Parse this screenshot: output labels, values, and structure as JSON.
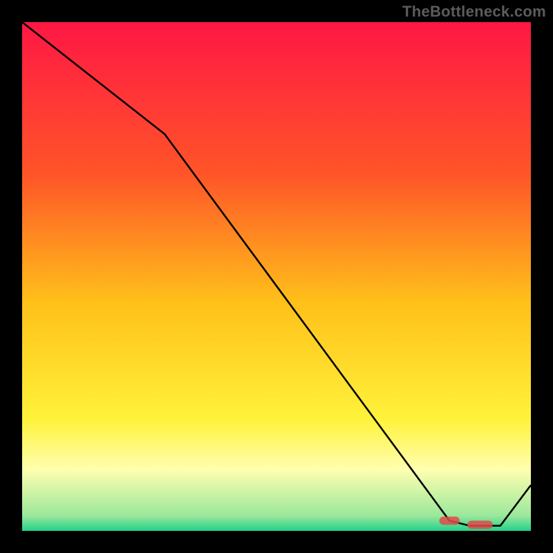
{
  "watermark": "TheBottleneck.com",
  "chart_data": {
    "type": "line",
    "title": "",
    "xlabel": "",
    "ylabel": "",
    "xlim": [
      0,
      100
    ],
    "ylim": [
      0,
      100
    ],
    "grid": false,
    "legend": false,
    "background_gradient": {
      "stops": [
        {
          "offset": 0.0,
          "color": "#ff1744"
        },
        {
          "offset": 0.3,
          "color": "#ff5528"
        },
        {
          "offset": 0.55,
          "color": "#ffc01a"
        },
        {
          "offset": 0.78,
          "color": "#fff23a"
        },
        {
          "offset": 0.88,
          "color": "#ffffb0"
        },
        {
          "offset": 0.97,
          "color": "#9be89b"
        },
        {
          "offset": 1.0,
          "color": "#23d18b"
        }
      ]
    },
    "series": [
      {
        "name": "bottleneck-curve",
        "color": "#000000",
        "x": [
          0,
          28,
          84,
          88,
          94,
          100
        ],
        "y": [
          100,
          78,
          2,
          1,
          1,
          9
        ]
      }
    ],
    "markers": {
      "name": "optimal-band",
      "color": "#e04a4a",
      "shape": "rounded-rect",
      "points": [
        {
          "x": 84,
          "y": 2,
          "w": 4.0,
          "h": 1.6
        },
        {
          "x": 90,
          "y": 1.2,
          "w": 5.0,
          "h": 1.6
        }
      ]
    }
  }
}
